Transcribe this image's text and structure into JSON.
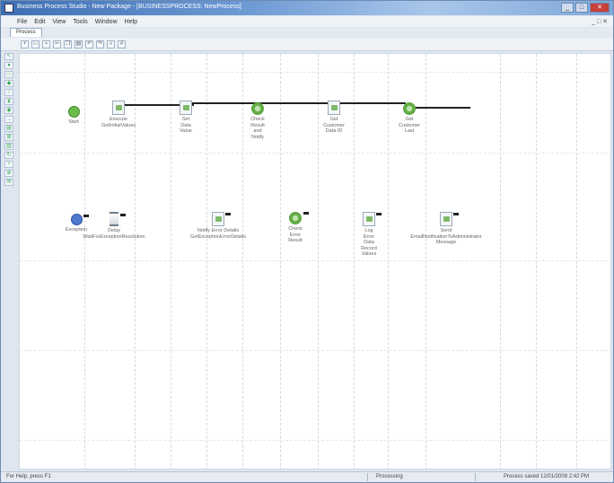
{
  "window": {
    "title": "Business Process Studio - New Package - [BUSINESSPROCESS: NewProcess]",
    "minimize": "_",
    "maximize": "□",
    "close": "✕"
  },
  "menu": {
    "items": [
      "File",
      "Edit",
      "View",
      "Tools",
      "Window",
      "Help"
    ],
    "mdi_controls": "_ □ ✕"
  },
  "doc_tab": "Process",
  "toolbar": {
    "buttons": [
      "new-icon",
      "open-icon",
      "save-icon",
      "cut-icon",
      "copy-icon",
      "paste-icon",
      "undo-icon",
      "redo-icon",
      "zoom-icon",
      "grid-icon"
    ]
  },
  "tools": {
    "buttons": [
      "pointer-icon",
      "start-icon",
      "task-icon",
      "gateway-icon",
      "event-icon",
      "timer-icon",
      "end-icon",
      "connector-icon",
      "note-icon",
      "subprocess-icon",
      "data-icon",
      "loop-icon",
      "split-icon",
      "join-icon",
      "message-icon"
    ]
  },
  "process": {
    "row1": [
      {
        "id": "n1",
        "type": "start",
        "label": "Start"
      },
      {
        "id": "n2",
        "type": "task",
        "label": "Execute\nGetInitialValues"
      },
      {
        "id": "n3",
        "type": "task",
        "label": "Set\nData\nValue"
      },
      {
        "id": "n4",
        "type": "gateway",
        "label": "Check\nResult\nand\nNotify"
      },
      {
        "id": "n5",
        "type": "task",
        "label": "Get\nCustomer\nData ID"
      },
      {
        "id": "n6",
        "type": "gateway",
        "label": "Get\nCustomer\nLast"
      }
    ],
    "row2": [
      {
        "id": "m1",
        "type": "start-blue",
        "label": "Exception"
      },
      {
        "id": "m2",
        "type": "timer",
        "label": "Delay\nWaitForExceptionResolution"
      },
      {
        "id": "m3",
        "type": "task",
        "label": "Notify Error Details\nGetExceptionErrorDetails"
      },
      {
        "id": "m4",
        "type": "gateway",
        "label": "Check\nError\nResult"
      },
      {
        "id": "m5",
        "type": "task",
        "label": "Log\nError\nData\nRecord\nValues"
      },
      {
        "id": "m6",
        "type": "task",
        "label": "Send\nEmailNotificationToAdministrator\nMessage"
      }
    ]
  },
  "status": {
    "left": "For Help, press F1",
    "middle": "Processing",
    "right": "Process saved 12/01/2008 2:42 PM"
  }
}
